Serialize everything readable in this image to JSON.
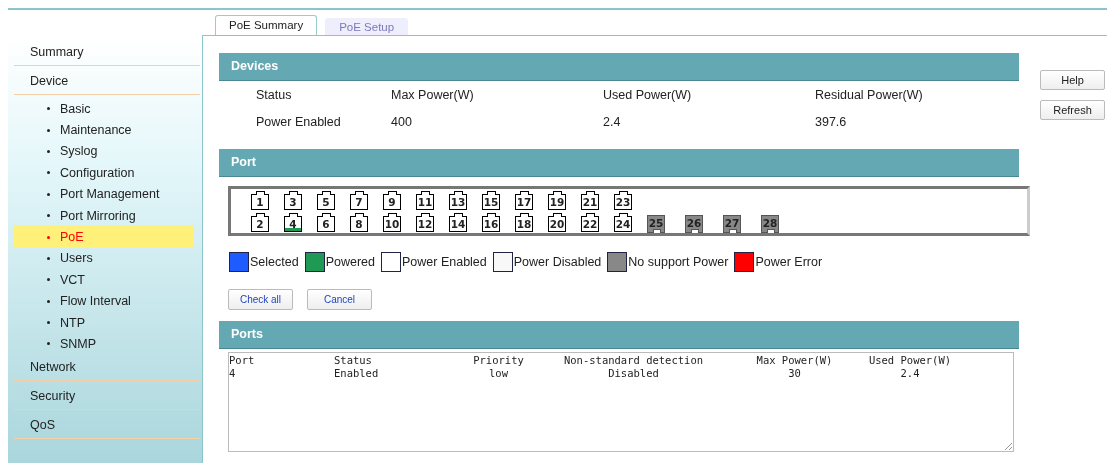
{
  "tabs": [
    {
      "label": "PoE Summary",
      "selected": true
    },
    {
      "label": "PoE Setup",
      "selected": false
    }
  ],
  "sidebar": {
    "items": [
      {
        "label": "Summary",
        "selected": false
      },
      {
        "label": "Device",
        "selected": false,
        "children": [
          {
            "label": "Basic",
            "selected": false
          },
          {
            "label": "Maintenance",
            "selected": false
          },
          {
            "label": "Syslog",
            "selected": false
          },
          {
            "label": "Configuration",
            "selected": false
          },
          {
            "label": "Port Management",
            "selected": false
          },
          {
            "label": "Port Mirroring",
            "selected": false
          },
          {
            "label": "PoE",
            "selected": true
          },
          {
            "label": "Users",
            "selected": false
          },
          {
            "label": "VCT",
            "selected": false
          },
          {
            "label": "Flow Interval",
            "selected": false
          },
          {
            "label": "NTP",
            "selected": false
          },
          {
            "label": "SNMP",
            "selected": false
          }
        ]
      },
      {
        "label": "Network",
        "selected": false
      },
      {
        "label": "Security",
        "selected": false
      },
      {
        "label": "QoS",
        "selected": false
      }
    ]
  },
  "devices": {
    "title": "Devices",
    "columns": [
      "Status",
      "Max Power(W)",
      "Used Power(W)",
      "Residual Power(W)"
    ],
    "values": [
      "Power Enabled",
      "400",
      "2.4",
      "397.6"
    ]
  },
  "port": {
    "title": "Port",
    "ports": [
      {
        "label": "1",
        "kind": "enabled"
      },
      {
        "label": "2",
        "kind": "enabled"
      },
      {
        "label": "3",
        "kind": "enabled"
      },
      {
        "label": "4",
        "kind": "powered"
      },
      {
        "label": "5",
        "kind": "enabled"
      },
      {
        "label": "6",
        "kind": "enabled"
      },
      {
        "label": "7",
        "kind": "enabled"
      },
      {
        "label": "8",
        "kind": "enabled"
      },
      {
        "label": "9",
        "kind": "enabled"
      },
      {
        "label": "10",
        "kind": "enabled"
      },
      {
        "label": "11",
        "kind": "enabled"
      },
      {
        "label": "12",
        "kind": "enabled"
      },
      {
        "label": "13",
        "kind": "enabled"
      },
      {
        "label": "14",
        "kind": "enabled"
      },
      {
        "label": "15",
        "kind": "enabled"
      },
      {
        "label": "16",
        "kind": "enabled"
      },
      {
        "label": "17",
        "kind": "enabled"
      },
      {
        "label": "18",
        "kind": "enabled"
      },
      {
        "label": "19",
        "kind": "enabled"
      },
      {
        "label": "20",
        "kind": "enabled"
      },
      {
        "label": "21",
        "kind": "enabled"
      },
      {
        "label": "22",
        "kind": "enabled"
      },
      {
        "label": "23",
        "kind": "enabled"
      },
      {
        "label": "24",
        "kind": "enabled"
      },
      {
        "label": "25",
        "kind": "nosupport"
      },
      {
        "label": "26",
        "kind": "nosupport"
      },
      {
        "label": "27",
        "kind": "nosupport"
      },
      {
        "label": "28",
        "kind": "nosupport"
      }
    ],
    "legend": [
      {
        "label": "Selected",
        "color": "#1e5cff"
      },
      {
        "label": "Powered",
        "color": "#1e9a55"
      },
      {
        "label": "Power Enabled",
        "color": "#ffffff"
      },
      {
        "label": "Power Disabled",
        "color": "#f8f8f8"
      },
      {
        "label": "No support Power",
        "color": "#888888"
      },
      {
        "label": "Power Error",
        "color": "#ff0000"
      }
    ],
    "buttons": [
      "Check all",
      "Cancel"
    ]
  },
  "ports": {
    "title": "Ports",
    "columns": [
      "Port",
      "Status",
      "Priority",
      "Non-standard detection",
      "Max Power(W)",
      "Used Power(W)"
    ],
    "rows": [
      [
        "4",
        "Enabled",
        "low",
        "Disabled",
        "30",
        "2.4"
      ]
    ]
  },
  "side_buttons": [
    "Help",
    "Refresh"
  ]
}
